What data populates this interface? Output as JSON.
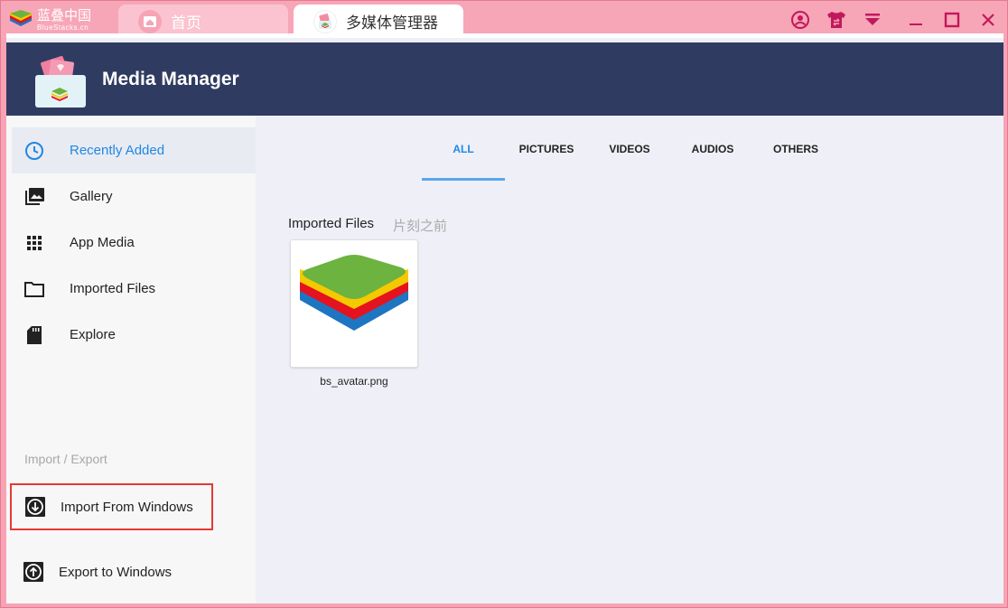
{
  "titlebar": {
    "brand_cn": "蓝叠中国",
    "brand_en": "BlueStacks.cn",
    "tabs": [
      {
        "label": "首页",
        "icon": "home-icon"
      },
      {
        "label": "多媒体管理器",
        "icon": "media-manager-icon"
      }
    ],
    "controls": [
      "account-icon",
      "theme-icon",
      "menu-icon",
      "minimize-icon",
      "maximize-icon",
      "close-icon"
    ]
  },
  "header": {
    "title": "Media Manager"
  },
  "sidebar": {
    "items": [
      {
        "label": "Recently Added",
        "icon": "clock-icon",
        "active": true
      },
      {
        "label": "Gallery",
        "icon": "gallery-icon"
      },
      {
        "label": "App Media",
        "icon": "grid-icon"
      },
      {
        "label": "Imported Files",
        "icon": "folder-icon"
      },
      {
        "label": "Explore",
        "icon": "sd-card-icon"
      }
    ],
    "section_label": "Import / Export",
    "actions": [
      {
        "label": "Import From Windows",
        "icon": "import-icon",
        "highlighted": true
      },
      {
        "label": "Export to Windows",
        "icon": "export-icon"
      }
    ]
  },
  "main": {
    "tabs": [
      {
        "label": "ALL",
        "active": true
      },
      {
        "label": "PICTURES"
      },
      {
        "label": "VIDEOS"
      },
      {
        "label": "AUDIOS"
      },
      {
        "label": "OTHERS"
      }
    ],
    "group": {
      "title": "Imported Files",
      "time": "片刻之前"
    },
    "files": [
      {
        "name": "bs_avatar.png",
        "icon": "bluestacks-logo"
      }
    ]
  },
  "colors": {
    "titlebar": "#f7a6b7",
    "header": "#2f3b61",
    "accent": "#1e88e5",
    "highlight_border": "#e53935"
  }
}
